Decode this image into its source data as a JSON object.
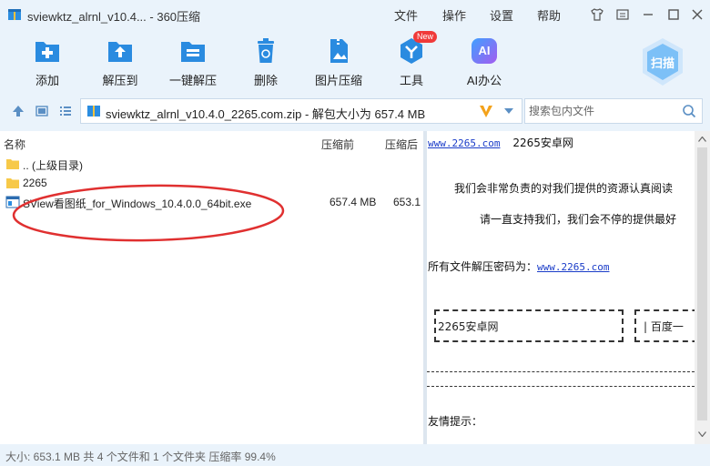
{
  "window": {
    "title": "sviewktz_alrnl_v10.4... - 360压缩",
    "menus": [
      "文件",
      "操作",
      "设置",
      "帮助"
    ]
  },
  "toolbar": {
    "items": [
      {
        "label": "添加",
        "icon": "add-icon"
      },
      {
        "label": "解压到",
        "icon": "extract-to-icon"
      },
      {
        "label": "一键解压",
        "icon": "one-click-extract-icon"
      },
      {
        "label": "删除",
        "icon": "trash-icon"
      },
      {
        "label": "图片压缩",
        "icon": "image-compress-icon"
      },
      {
        "label": "工具",
        "icon": "tools-icon",
        "badge": "New"
      },
      {
        "label": "AI办公",
        "icon": "ai-office-icon",
        "icon_text": "AI"
      }
    ],
    "scan_label": "扫描"
  },
  "address": {
    "path": "sviewktz_alrnl_v10.4.0_2265.com.zip - 解包大小为 657.4 MB",
    "search_placeholder": "搜索包内文件"
  },
  "filelist": {
    "columns": {
      "name": "名称",
      "size": "压缩前",
      "packed": "压缩后"
    },
    "rows": [
      {
        "name": ".. (上级目录)",
        "type": "folder",
        "size": "",
        "packed": ""
      },
      {
        "name": "2265",
        "type": "folder",
        "size": "",
        "packed": ""
      },
      {
        "name": "SView看图纸_for_Windows_10.4.0.0_64bit.exe",
        "type": "exe",
        "size": "657.4 MB",
        "packed": "653.1"
      }
    ]
  },
  "preview": {
    "site_link": "www.2265.com",
    "site_name": "2265安卓网",
    "para1": "我们会非常负责的对我们提供的资源认真阅读",
    "para2": "请一直支持我们，我们会不停的提供最好",
    "password_label": "所有文件解压密码为：",
    "password_link": "www.2265.com",
    "box1": "2265安卓网",
    "box2": "| 百度一",
    "tip": "友情提示："
  },
  "status": {
    "text": "大小: 653.1 MB 共 4 个文件和 1 个文件夹 压缩率 99.4%"
  },
  "colors": {
    "chrome_bg": "#eaf3fb",
    "accent_blue": "#2a8be0",
    "annotation_red": "#e03030"
  }
}
